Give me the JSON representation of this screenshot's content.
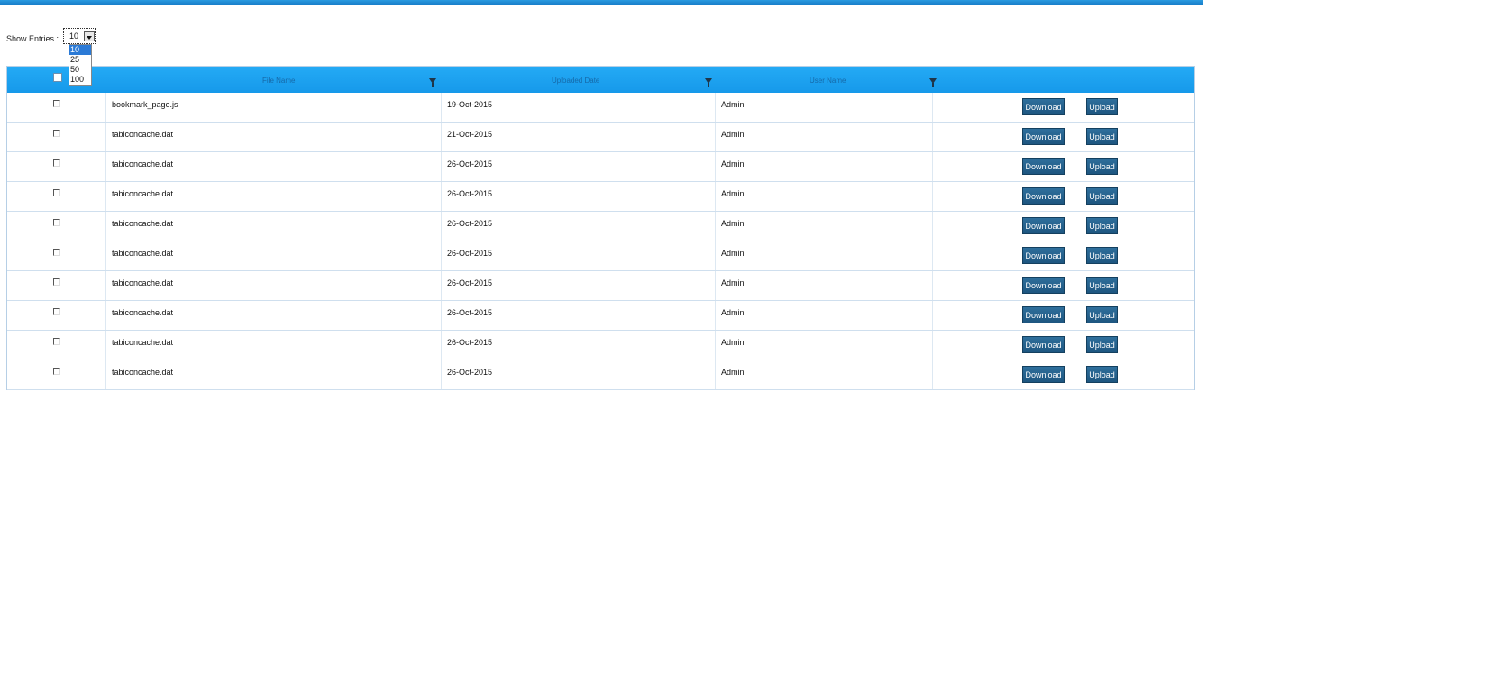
{
  "entries": {
    "label": "Show Entries :",
    "selected": "10",
    "options": [
      "10",
      "25",
      "50",
      "100"
    ]
  },
  "table": {
    "columns": [
      "File Name",
      "Uploaded Date",
      "User Name"
    ],
    "download_label": "Download",
    "upload_label": "Upload",
    "rows": [
      {
        "file": "bookmark_page.js",
        "date": "19-Oct-2015",
        "user": "Admin"
      },
      {
        "file": "tabiconcache.dat",
        "date": "21-Oct-2015",
        "user": "Admin"
      },
      {
        "file": "tabiconcache.dat",
        "date": "26-Oct-2015",
        "user": "Admin"
      },
      {
        "file": "tabiconcache.dat",
        "date": "26-Oct-2015",
        "user": "Admin"
      },
      {
        "file": "tabiconcache.dat",
        "date": "26-Oct-2015",
        "user": "Admin"
      },
      {
        "file": "tabiconcache.dat",
        "date": "26-Oct-2015",
        "user": "Admin"
      },
      {
        "file": "tabiconcache.dat",
        "date": "26-Oct-2015",
        "user": "Admin"
      },
      {
        "file": "tabiconcache.dat",
        "date": "26-Oct-2015",
        "user": "Admin"
      },
      {
        "file": "tabiconcache.dat",
        "date": "26-Oct-2015",
        "user": "Admin"
      },
      {
        "file": "tabiconcache.dat",
        "date": "26-Oct-2015",
        "user": "Admin"
      }
    ]
  },
  "colors": {
    "header_bar": "#1a9eec",
    "button": "#276590",
    "top_bar": "#1f88d0"
  }
}
